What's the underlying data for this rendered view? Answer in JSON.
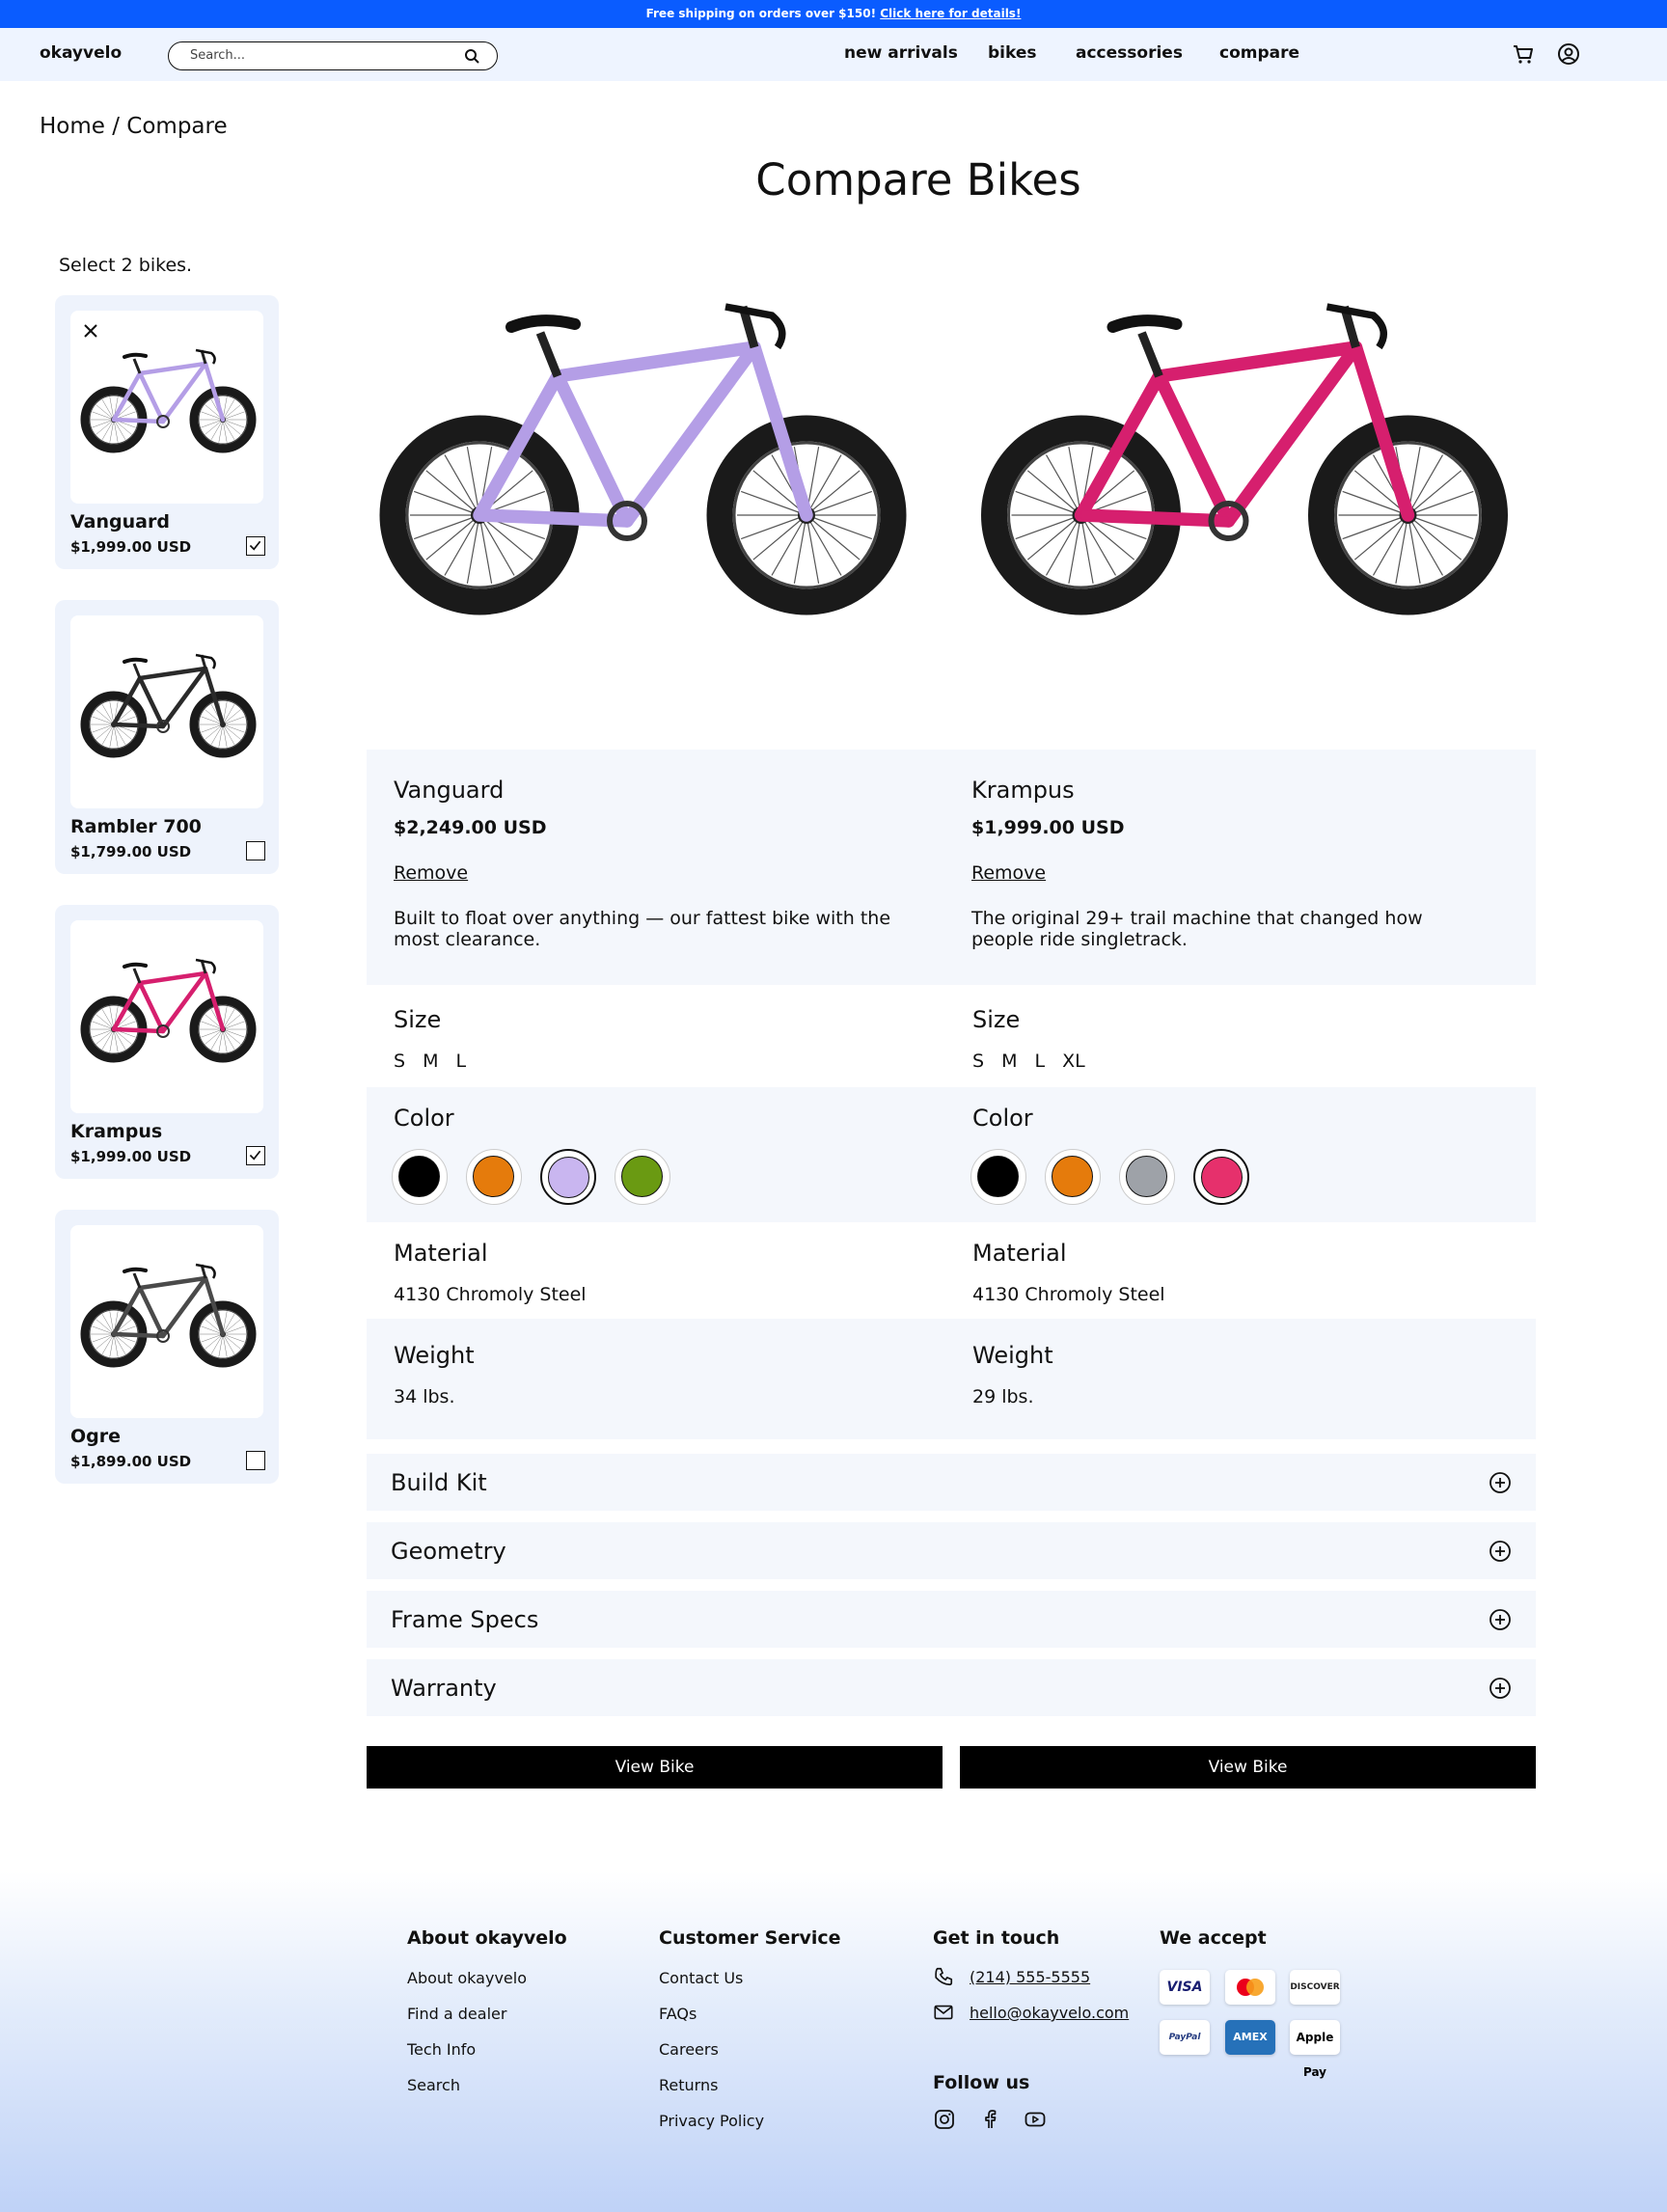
{
  "promo": {
    "text": "Free shipping on orders over $150! ",
    "link": "Click here for details!"
  },
  "header": {
    "brand": "okayvelo",
    "search_placeholder": "Search...",
    "nav": [
      "new arrivals",
      "bikes",
      "accessories",
      "compare"
    ]
  },
  "breadcrumb": "Home / Compare",
  "page_title": "Compare Bikes",
  "sidebar": {
    "hint": "Select 2 bikes.",
    "cards": [
      {
        "name": "Vanguard",
        "price": "$1,999.00 USD",
        "checked": true,
        "color": "#b49ee6"
      },
      {
        "name": "Rambler 700",
        "price": "$1,799.00 USD",
        "checked": false,
        "color": "#2a2a2a"
      },
      {
        "name": "Krampus",
        "price": "$1,999.00 USD",
        "checked": true,
        "color": "#d61f6e"
      },
      {
        "name": "Ogre",
        "price": "$1,899.00 USD",
        "checked": false,
        "color": "#4a4a4a"
      }
    ]
  },
  "compare": {
    "left": {
      "name": "Vanguard",
      "price": "$2,249.00 USD",
      "remove": "Remove",
      "description": "Built to float over anything — our fattest bike with the most clearance.",
      "size_label": "Size",
      "sizes": [
        "S",
        "M",
        "L"
      ],
      "color_label": "Color",
      "colors": [
        "#000000",
        "#e57b0c",
        "#c9b6f0",
        "#6a9a12"
      ],
      "selected_color": 2,
      "material_label": "Material",
      "material": "4130 Chromoly Steel",
      "weight_label": "Weight",
      "weight": "34 lbs.",
      "frame_color": "#b49ee6"
    },
    "right": {
      "name": "Krampus",
      "price": "$1,999.00 USD",
      "remove": "Remove",
      "description": "The original 29+ trail machine that changed how people ride singletrack.",
      "size_label": "Size",
      "sizes": [
        "S",
        "M",
        "L",
        "XL"
      ],
      "color_label": "Color",
      "colors": [
        "#000000",
        "#e57b0c",
        "#9ea2a8",
        "#e6306c"
      ],
      "selected_color": 3,
      "material_label": "Material",
      "material": "4130 Chromoly Steel",
      "weight_label": "Weight",
      "weight": "29 lbs.",
      "frame_color": "#d61f6e"
    }
  },
  "accordions": [
    "Build Kit",
    "Geometry",
    "Frame Specs",
    "Warranty"
  ],
  "view_bike_label": "View Bike",
  "footer": {
    "about": {
      "heading": "About okayvelo",
      "links": [
        "About okayvelo",
        "Find a dealer",
        "Tech Info",
        "Search"
      ]
    },
    "service": {
      "heading": "Customer Service",
      "links": [
        "Contact Us",
        "FAQs",
        "Careers",
        "Returns",
        "Privacy Policy"
      ]
    },
    "contact": {
      "heading": "Get in touch",
      "phone": "(214) 555-5555",
      "email": "hello@okayvelo.com"
    },
    "follow": {
      "heading": "Follow us",
      "icons": [
        "instagram-icon",
        "facebook-icon",
        "youtube-icon"
      ]
    },
    "payments": {
      "heading": "We accept",
      "methods": [
        "VISA",
        "Mastercard",
        "DISCOVER",
        "PayPal",
        "AMEX",
        "Apple Pay"
      ]
    }
  }
}
